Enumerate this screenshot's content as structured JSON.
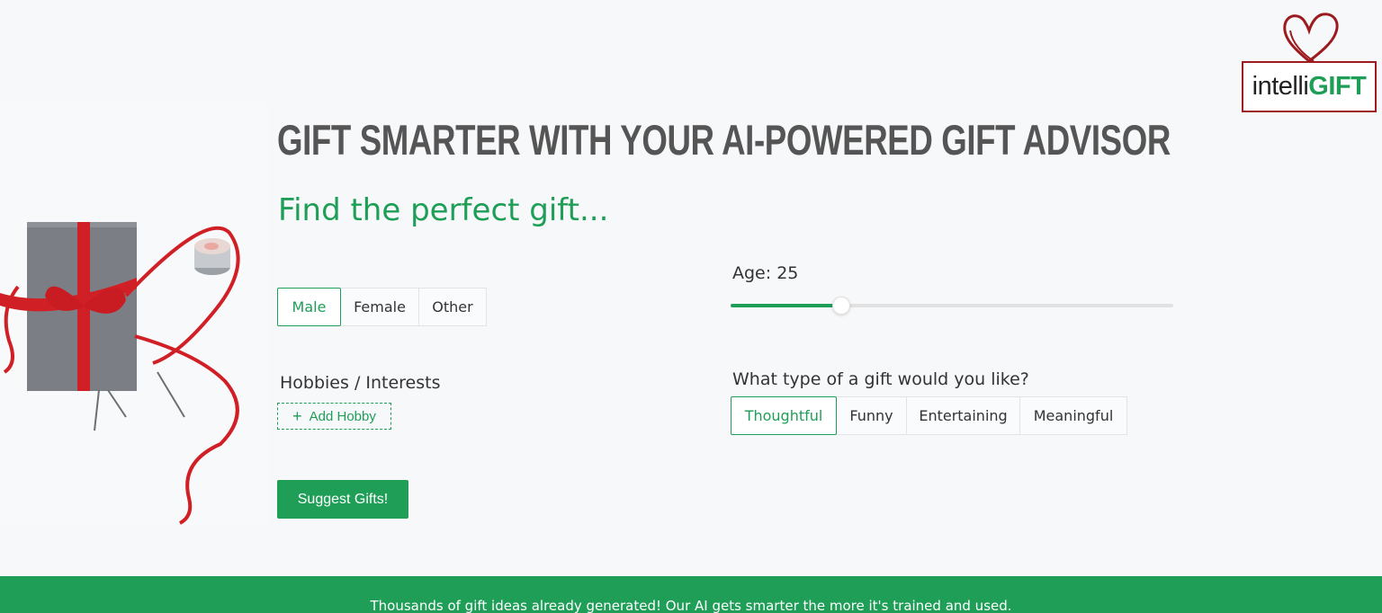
{
  "logo": {
    "intelli": "intelli",
    "gift": "GIFT"
  },
  "headline": "GIFT SMARTER WITH YOUR AI-POWERED GIFT ADVISOR",
  "subhead": "Find the perfect gift...",
  "gender": {
    "options": [
      "Male",
      "Female",
      "Other"
    ],
    "selected": "Male"
  },
  "age": {
    "label": "Age: 25",
    "value": 25,
    "fraction": 0.25
  },
  "hobbies": {
    "label": "Hobbies / Interests",
    "add_button": "Add Hobby"
  },
  "gift_type": {
    "label": "What type of a gift would you like?",
    "options": [
      "Thoughtful",
      "Funny",
      "Entertaining",
      "Meaningful"
    ],
    "selected": "Thoughtful"
  },
  "suggest_button": "Suggest Gifts!",
  "footer": "Thousands of gift ideas already generated! Our AI gets smarter the more it's trained and used.",
  "colors": {
    "brand_green": "#1e9e57",
    "logo_red": "#9b1b1f"
  }
}
